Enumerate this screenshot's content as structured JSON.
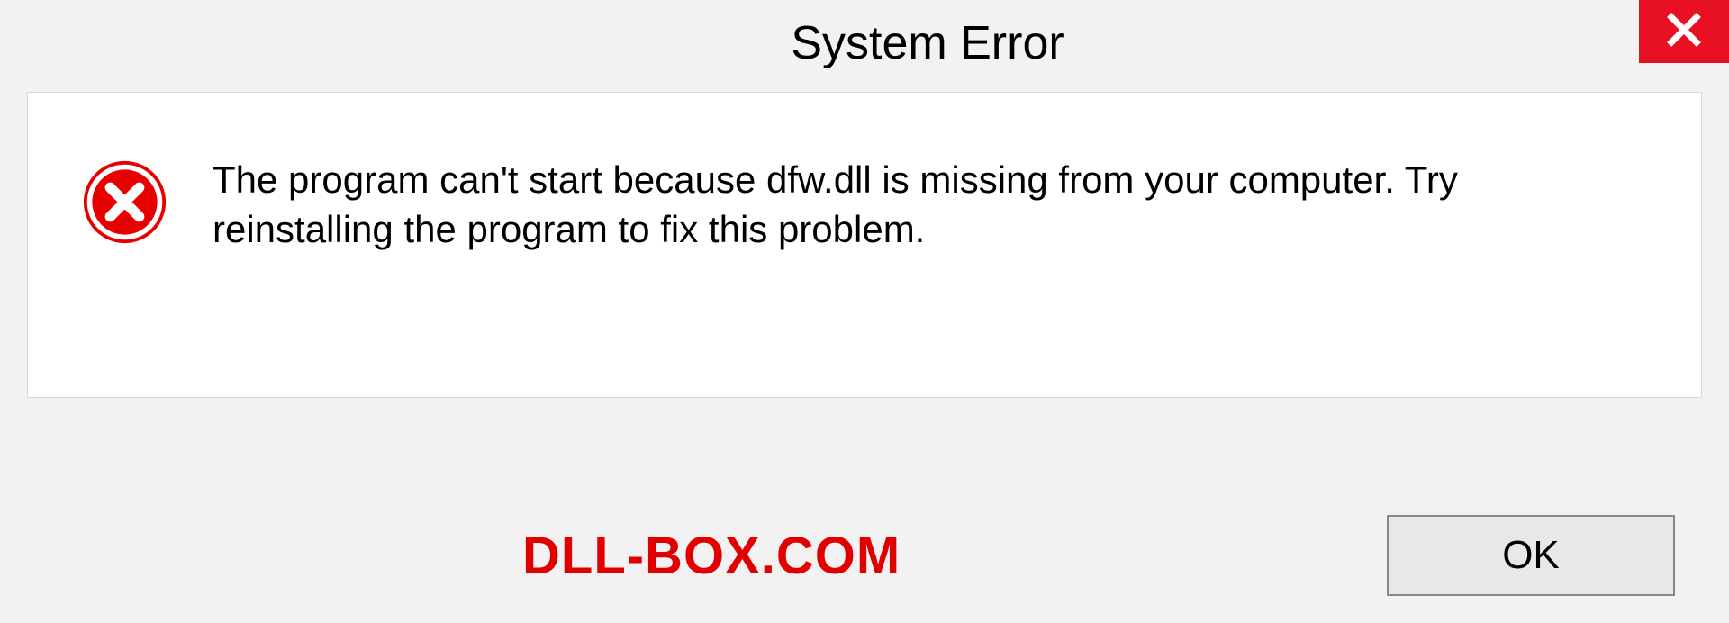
{
  "dialog": {
    "title": "System Error",
    "message": "The program can't start because dfw.dll is missing from your computer. Try reinstalling the program to fix this problem.",
    "ok_label": "OK"
  },
  "watermark": "DLL-BOX.COM"
}
